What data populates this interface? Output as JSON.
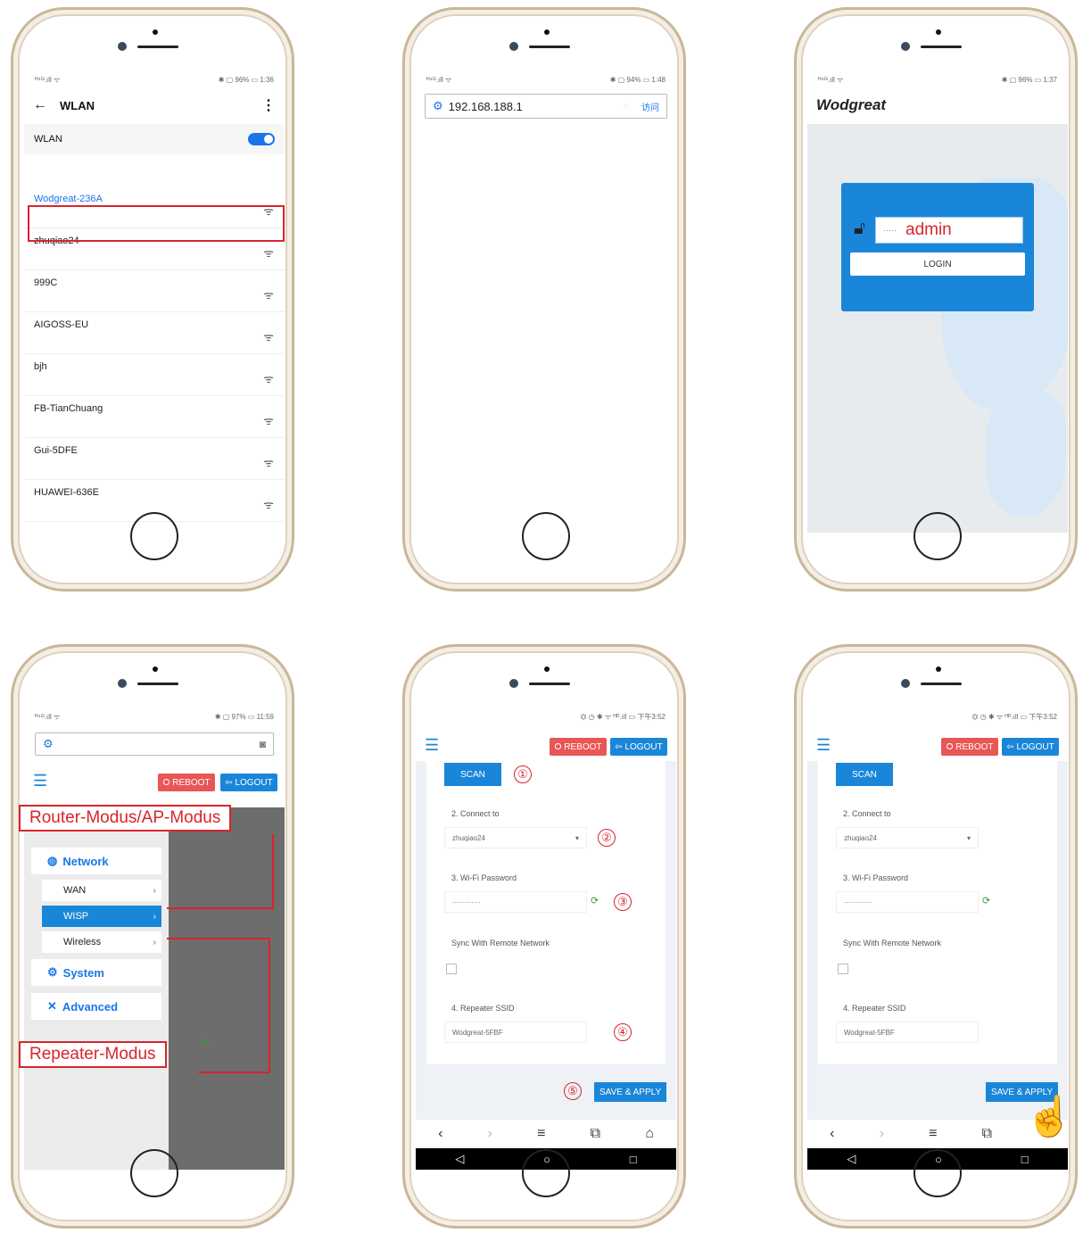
{
  "p1": {
    "status_left": "ᴴ⁴ᴳ.ıll ᯤ",
    "status_right": "✱ ▢ 96% ▭ 1:36",
    "title": "WLAN",
    "toggle_label": "WLAN",
    "networks": [
      "Wodgreat-236A",
      "zhuqiao24",
      "999C",
      "AIGOSS-EU",
      "bjh",
      "FB-TianChuang",
      "Gui-5DFE",
      "HUAWEI-636E"
    ]
  },
  "p2": {
    "status_left": "ᴴ⁴ᴳ.ıll ᯤ",
    "status_right": "✱ ▢ 94% ▭ 1:48",
    "url": "192.168.188.1",
    "go": "访问"
  },
  "p3": {
    "status_left": "ᴴ⁴ᴳ.ıll ᯤ",
    "status_right": "✱ ▢ 96% ▭ 1:37",
    "brand": "Wodgreat",
    "password": "admin",
    "mask": "·····",
    "login": "LOGIN"
  },
  "p4": {
    "status_left": "ᴴ⁴ᴳ.ıll ᯤ",
    "status_right": "✱ ▢ 97% ▭ 11:59",
    "reboot": "⭘ REBOOT",
    "logout": "⇦ LOGOUT",
    "menu": {
      "network": "Network",
      "wan": "WAN",
      "wisp": "WISP",
      "wireless": "Wireless",
      "system": "System",
      "advanced": "Advanced"
    },
    "callout_router": "Router-Modus/AP-Modus",
    "callout_repeater": "Repeater-Modus"
  },
  "form": {
    "status_right": "⏣ ◷ ✱ ᯤ ᴴᴰ.ıll ▭ 下午3:52",
    "reboot": "⭘ REBOOT",
    "logout": "⇦ LOGOUT",
    "scan": "SCAN",
    "connect_label": "2. Connect to",
    "connect_value": "zhuqiao24",
    "pw_label": "3. Wi-Fi Password",
    "pw_value": "············",
    "sync_label": "Sync With Remote Network",
    "ssid_label": "4. Repeater SSID",
    "ssid_value": "Wodgreat-5FBF",
    "save": "SAVE & APPLY",
    "steps": [
      "①",
      "②",
      "③",
      "④",
      "⑤"
    ]
  },
  "colors": {
    "accent": "#1a86d9",
    "callout": "#d9242b",
    "reboot": "#e95656"
  }
}
